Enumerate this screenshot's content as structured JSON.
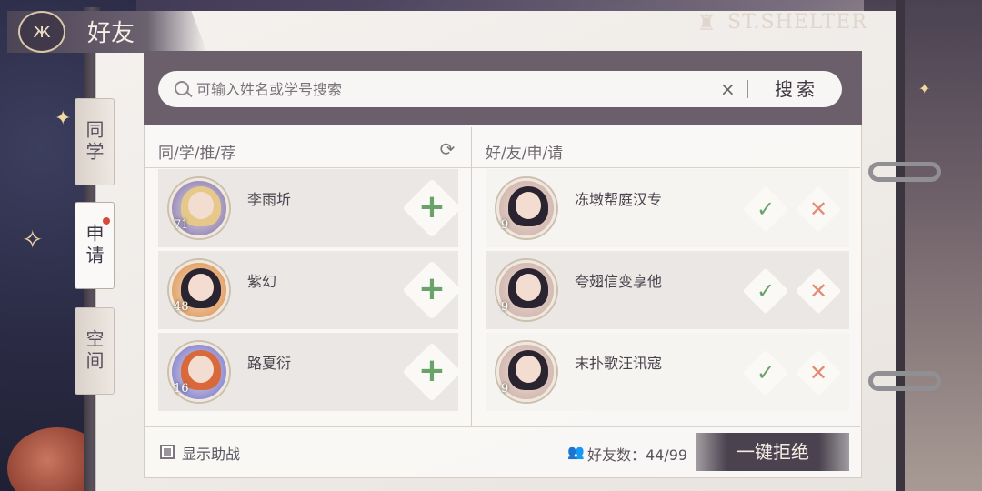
{
  "header": {
    "title": "好友",
    "title_emblem_icon": "butterfly-icon",
    "brand": "ST.SHELTER"
  },
  "side_tabs": [
    {
      "label": "同学",
      "active": false
    },
    {
      "label": "申请",
      "active": true,
      "has_notification": true
    },
    {
      "label": "空间",
      "active": false
    }
  ],
  "search": {
    "placeholder": "可输入姓名或学号搜索",
    "value": "",
    "clear_label": "×",
    "button_label": "搜索"
  },
  "recommend": {
    "header": "同/学/推/荐",
    "refresh_icon": "refresh-icon",
    "items": [
      {
        "name": "李雨圻",
        "level": "71",
        "hair": "#e6c98a",
        "frame": "#7a6db0"
      },
      {
        "name": "紫幻",
        "level": "48",
        "hair": "#2a2330",
        "frame": "#e08a3c"
      },
      {
        "name": "路夏衍",
        "level": "16",
        "hair": "#d9683a",
        "frame": "#6a6ad0"
      }
    ],
    "add_glyph": "+"
  },
  "requests": {
    "header": "好/友/申/请",
    "items": [
      {
        "name": "冻墩帮庭汉专",
        "level": "9",
        "hair": "#2a2330"
      },
      {
        "name": "夸翅信变享他",
        "level": "9",
        "hair": "#2a2330"
      },
      {
        "name": "末扑歌汪讯寇",
        "level": "9",
        "hair": "#2a2330"
      }
    ],
    "accept_glyph": "✓",
    "reject_glyph": "✕"
  },
  "footer": {
    "show_support_label": "显示助战",
    "show_support_checked": true,
    "friends_count_label": "好友数：44/99",
    "reject_all_label": "一键拒绝"
  },
  "colors": {
    "accent_green": "#6aa36a",
    "reject_orange": "#e48a73",
    "notification_red": "#d74a3a",
    "banner_dark": "#4a424e"
  }
}
